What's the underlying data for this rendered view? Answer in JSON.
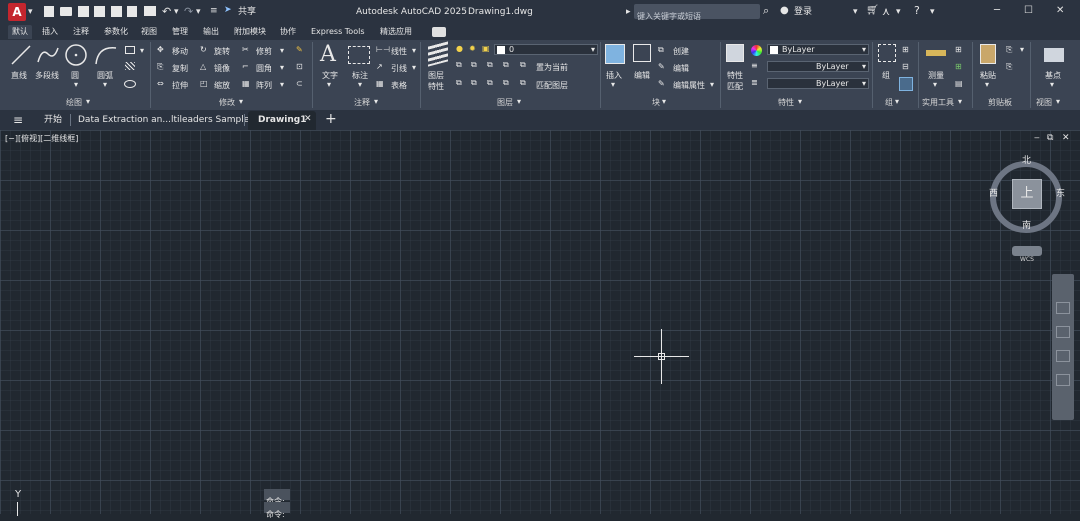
{
  "titlebar": {
    "app_title": "Autodesk AutoCAD 2025",
    "doc_title": "Drawing1.dwg",
    "share_label": "共享",
    "search_placeholder": "键入关键字或短语",
    "login_label": "登录"
  },
  "menu_tabs": [
    "默认",
    "插入",
    "注释",
    "参数化",
    "视图",
    "管理",
    "输出",
    "附加模块",
    "协作",
    "Express Tools",
    "精选应用"
  ],
  "ribbon": {
    "draw": {
      "line": "直线",
      "polyline": "多段线",
      "circle": "圆",
      "arc": "圆弧",
      "panel": "绘图"
    },
    "modify": {
      "move": "移动",
      "rotate": "旋转",
      "trim": "修剪",
      "copy": "复制",
      "mirror": "镜像",
      "fillet": "圆角",
      "stretch": "拉伸",
      "scale": "缩放",
      "array": "阵列",
      "panel": "修改"
    },
    "annotation": {
      "text": "文字",
      "dimension": "标注",
      "linear": "线性",
      "leader": "引线",
      "table": "表格",
      "panel": "注释"
    },
    "layers": {
      "layer_properties": "图层特性",
      "current_layer": "0",
      "set_current": "置为当前",
      "match_layer": "匹配图层",
      "panel": "图层"
    },
    "block": {
      "insert": "插入",
      "edit": "编辑",
      "create": "创建",
      "edit_attr": "编辑属性",
      "panel": "块"
    },
    "properties": {
      "match": "特性匹配",
      "color": "ByLayer",
      "linetype": "ByLayer",
      "lineweight": "ByLayer",
      "panel": "特性"
    },
    "groups": {
      "group": "组",
      "panel": "组"
    },
    "utilities": {
      "measure": "测量",
      "panel": "实用工具"
    },
    "clipboard": {
      "paste": "粘贴",
      "panel": "剪贴板"
    },
    "view": {
      "base": "基点",
      "panel": "视图"
    }
  },
  "file_tabs": {
    "start": "开始",
    "tab1": "Data Extraction an...ltileaders Sample*",
    "tab2": "Drawing1"
  },
  "viewport": {
    "label": "[−][俯视][二维线框]",
    "viewcube_top": "上",
    "north": "北",
    "south": "南",
    "east": "东",
    "west": "西",
    "wcs": "WCS",
    "command_1": "命令:",
    "command_2": "命令:",
    "ucs_y": "Y"
  },
  "colors": {
    "accent_red": "#c4262e",
    "bg": "#212830",
    "ribbon": "#3b4453",
    "titlebar": "#2b3340"
  }
}
